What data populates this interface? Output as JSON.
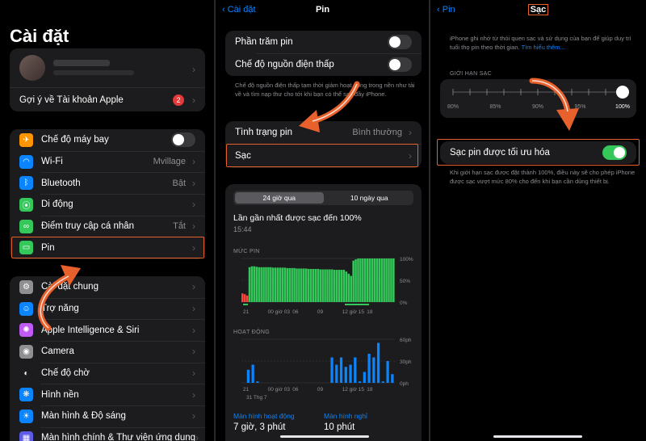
{
  "settings": {
    "title": "Cài đặt",
    "apple_suggest": "Gợi ý về Tài khoản Apple",
    "apple_badge": "2",
    "items1": [
      {
        "label": "Chế độ máy bay",
        "value": "",
        "icon": "airplane-icon",
        "color": "#ff9500",
        "glyph": "✈",
        "toggle": true
      },
      {
        "label": "Wi-Fi",
        "value": "Mvillage",
        "icon": "wifi-icon",
        "color": "#0a84ff",
        "glyph": "◠"
      },
      {
        "label": "Bluetooth",
        "value": "Bật",
        "icon": "bluetooth-icon",
        "color": "#0a84ff",
        "glyph": "ᛒ"
      },
      {
        "label": "Di động",
        "value": "",
        "icon": "cellular-icon",
        "color": "#34c759",
        "glyph": "⦿"
      },
      {
        "label": "Điểm truy cập cá nhân",
        "value": "Tắt",
        "icon": "hotspot-icon",
        "color": "#34c759",
        "glyph": "∞"
      },
      {
        "label": "Pin",
        "value": "",
        "icon": "battery-icon",
        "color": "#34c759",
        "glyph": "▭"
      }
    ],
    "items2": [
      {
        "label": "Cài đặt chung",
        "icon": "gear-icon",
        "color": "#8e8e93",
        "glyph": "⚙"
      },
      {
        "label": "Trợ năng",
        "icon": "accessibility-icon",
        "color": "#0a84ff",
        "glyph": "☺"
      },
      {
        "label": "Apple Intelligence & Siri",
        "icon": "siri-icon",
        "color": "#bf5af2",
        "glyph": "✺"
      },
      {
        "label": "Camera",
        "icon": "camera-icon",
        "color": "#8e8e93",
        "glyph": "◉"
      },
      {
        "label": "Chế độ chờ",
        "icon": "standby-icon",
        "color": "#1c1c1e",
        "glyph": "◐"
      },
      {
        "label": "Hình nền",
        "icon": "wallpaper-icon",
        "color": "#0a84ff",
        "glyph": "❋"
      },
      {
        "label": "Màn hình & Độ sáng",
        "icon": "brightness-icon",
        "color": "#0a84ff",
        "glyph": "☀"
      },
      {
        "label": "Màn hình chính & Thư viện ứng dụng",
        "icon": "home-screen-icon",
        "color": "#5e5ce6",
        "glyph": "▦"
      }
    ]
  },
  "battery": {
    "back": "Cài đặt",
    "title": "Pin",
    "percent_label": "Phần trăm pin",
    "low_power_label": "Chế độ nguồn điện thấp",
    "low_power_note": "Chế độ nguồn điện thấp tạm thời giảm hoạt động trong nền như tải về và tìm nạp thư cho tới khi bạn có thể sạc đầy iPhone.",
    "health_label": "Tình trạng pin",
    "health_value": "Bình thường",
    "charging_label": "Sạc",
    "tab_24h": "24 giờ qua",
    "tab_10d": "10 ngày qua",
    "last_charged": "Lần gần nhất được sạc đến 100%",
    "last_time": "15:44",
    "level_head": "MỨC PIN",
    "level_ticks": [
      "100%",
      "50%",
      "0%"
    ],
    "x_ticks": [
      "21",
      "00 giờ 03",
      "06",
      "09",
      "12 giờ 15",
      "18"
    ],
    "activity_head": "HOẠT ĐỘNG",
    "activity_ticks": [
      "60ph",
      "30ph",
      "0ph"
    ],
    "date_label": "31 Thg 7",
    "screen_on_label": "Màn hình hoạt động",
    "screen_on_value": "7 giờ, 3 phút",
    "screen_off_label": "Màn hình nghỉ",
    "screen_off_value": "10 phút"
  },
  "chart_data": [
    {
      "type": "bar",
      "title": "MỨC PIN",
      "ylabel": "",
      "ylim": [
        0,
        100
      ],
      "y_ticks": [
        "0%",
        "50%",
        "100%"
      ],
      "categories": [
        "21",
        "00 giờ 03",
        "06",
        "09",
        "12 giờ 15",
        "18"
      ],
      "values": [
        20,
        18,
        15,
        80,
        82,
        82,
        81,
        80,
        80,
        80,
        80,
        80,
        80,
        79,
        79,
        79,
        79,
        79,
        79,
        78,
        78,
        78,
        78,
        77,
        77,
        77,
        77,
        77,
        76,
        76,
        76,
        76,
        76,
        75,
        75,
        75,
        75,
        75,
        75,
        74,
        74,
        74,
        74,
        74,
        70,
        65,
        60,
        95,
        98,
        100,
        100,
        100,
        100,
        100,
        100,
        100,
        100,
        100,
        100,
        100,
        100,
        100,
        100,
        100,
        100
      ]
    },
    {
      "type": "bar",
      "title": "HOẠT ĐỘNG",
      "ylim": [
        0,
        60
      ],
      "y_ticks": [
        "0ph",
        "30ph",
        "60ph"
      ],
      "categories": [
        "21",
        "00 giờ 03",
        "06",
        "09",
        "12 giờ 15",
        "18"
      ],
      "values": [
        0,
        18,
        25,
        2,
        0,
        0,
        0,
        0,
        0,
        0,
        0,
        0,
        0,
        0,
        0,
        0,
        0,
        0,
        0,
        35,
        25,
        35,
        22,
        25,
        35,
        2,
        15,
        40,
        35,
        55,
        2,
        30,
        12
      ]
    }
  ],
  "charging": {
    "back": "Pin",
    "title": "Sạc",
    "intro": "iPhone ghi nhớ từ thói quen sạc và sử dụng của bạn để giúp duy trì tuổi thọ pin theo thời gian.",
    "learn_more": "Tìm hiểu thêm...",
    "limit_head": "GIỚI HẠN SẠC",
    "limit_value": 100,
    "limit_ticks": [
      "80%",
      "85%",
      "90%",
      "95%",
      "100%"
    ],
    "optimized_label": "Sạc pin được tối ưu hóa",
    "optimized_note": "Khi giới hạn sạc được đặt thành 100%, điều này sẽ cho phép iPhone được sạc vượt mức 80% cho đến khi bạn cần dùng thiết bị."
  },
  "accent": "#e8602c"
}
